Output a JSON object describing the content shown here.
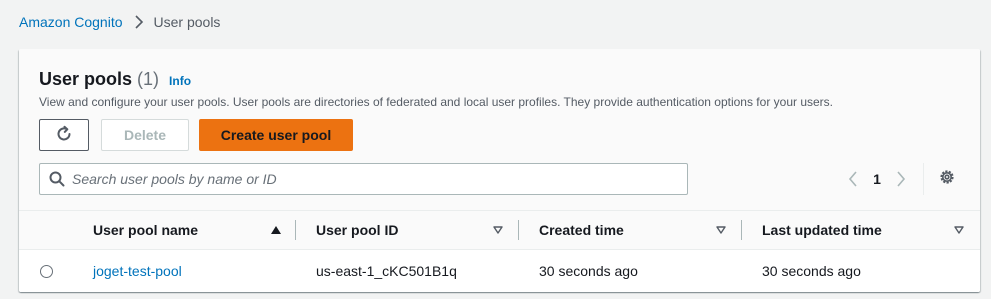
{
  "breadcrumb": {
    "items": [
      "Amazon Cognito",
      "User pools"
    ]
  },
  "header": {
    "title": "User pools",
    "count": "(1)",
    "info_label": "Info",
    "description": "View and configure your user pools. User pools are directories of federated and local user profiles. They provide authentication options for your users."
  },
  "actions": {
    "refresh_icon": "refresh-icon",
    "delete_label": "Delete",
    "create_label": "Create user pool",
    "create_color": "#ec7211"
  },
  "search": {
    "placeholder": "Search user pools by name or ID",
    "value": ""
  },
  "pagination": {
    "current_page": "1"
  },
  "table": {
    "columns": [
      {
        "label": "User pool name",
        "sort": "ascending"
      },
      {
        "label": "User pool ID",
        "sort": "none"
      },
      {
        "label": "Created time",
        "sort": "none"
      },
      {
        "label": "Last updated time",
        "sort": "none"
      }
    ],
    "rows": [
      {
        "name": "joget-test-pool",
        "id": "us-east-1_cKC501B1q",
        "created": "30 seconds ago",
        "updated": "30 seconds ago",
        "selected": false
      }
    ]
  },
  "colors": {
    "link": "#0073bb",
    "primary_button": "#ec7211",
    "disabled_text": "#aab7b8"
  }
}
